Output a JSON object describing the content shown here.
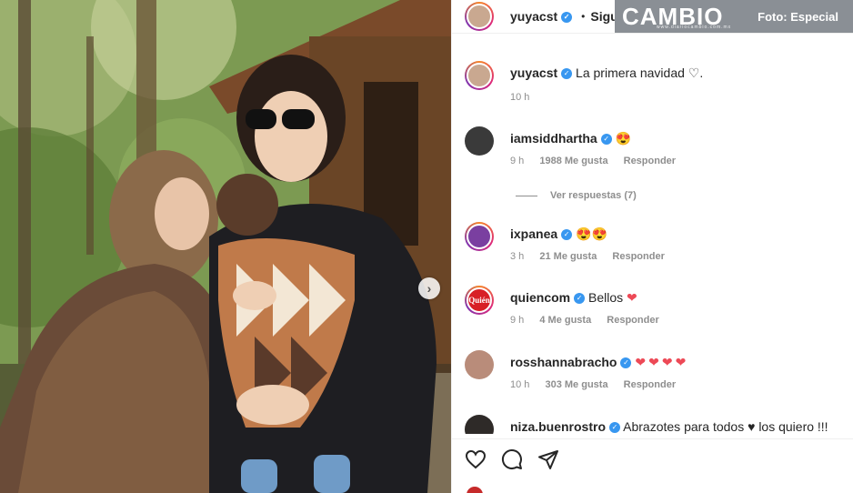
{
  "header": {
    "username": "yuyacst",
    "separator": "•",
    "follow_label": "Siguiendo"
  },
  "watermark": {
    "logo": "CAMBIO",
    "site": "www.diariocambio.com.mx",
    "credit": "Foto: Especial"
  },
  "caption": {
    "username": "yuyacst",
    "text": "La primera navidad ♡.",
    "time": "10 h"
  },
  "comments": [
    {
      "username": "iamsiddhartha",
      "text": "😍",
      "time": "9 h",
      "likes": "1988 Me gusta",
      "reply": "Responder",
      "avatar_color": "#3a3a3a"
    },
    {
      "username": "ixpanea",
      "text": "😍😍",
      "time": "3 h",
      "likes": "21 Me gusta",
      "reply": "Responder",
      "avatar_color": "#7a3fa0"
    },
    {
      "username": "quiencom",
      "text": "Bellos",
      "hearts": "❤",
      "time": "9 h",
      "likes": "4 Me gusta",
      "reply": "Responder",
      "avatar_color": "#d81f26",
      "avatar_text": "Quién"
    },
    {
      "username": "rosshannabracho",
      "text": "",
      "hearts": "❤❤❤❤",
      "time": "10 h",
      "likes": "303 Me gusta",
      "reply": "Responder",
      "avatar_color": "#b98c7a"
    },
    {
      "username": "niza.buenrostro",
      "text": "Abrazotes para todos ♥ los quiero !!!",
      "avatar_color": "#2e2a28"
    }
  ],
  "view_replies": "Ver respuestas (7)",
  "icons": [
    "heart-icon",
    "comment-icon",
    "share-icon",
    "next-arrow-icon"
  ],
  "colors": {
    "verified": "#3897f0",
    "heart": "#ed4956",
    "meta": "#8e8e8e",
    "watermark_bg": "#8a8f95"
  }
}
